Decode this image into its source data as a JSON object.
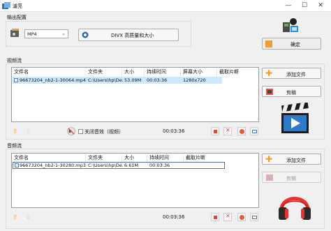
{
  "window": {
    "title": "濾亮",
    "controls": [
      "—",
      "☐",
      "✕"
    ]
  },
  "output_config": {
    "label": "输出配置",
    "format": "MP4",
    "quality": "DIVX 高质量和大小",
    "ok_label": "确定"
  },
  "video": {
    "label": "视频流",
    "columns": [
      "文件名",
      "文件夹",
      "大小",
      "持续时间",
      "屏幕大小",
      "截取片断"
    ],
    "rows": [
      {
        "name": "96673204_nb2-1-30064.mp4",
        "folder": "C:\\Users\\hp\\De...",
        "size": "53.09M",
        "duration": "00:03:36",
        "screen": "1280x720",
        "clip": ""
      }
    ],
    "add_label": "添加文件",
    "edit_label": "剪辑",
    "mute_label": "关闭音效（视频）",
    "total_time": "00:03:36"
  },
  "audio": {
    "label": "音频流",
    "columns": [
      "文件名",
      "文件夹",
      "大小",
      "持续时间",
      "截取片断"
    ],
    "rows": [
      {
        "name": "96673204_nb2-1-30280.mp3",
        "folder": "C:\\Users\\hp\\De...",
        "size": "6.61M",
        "duration": "00:03:36",
        "clip": ""
      }
    ],
    "add_label": "添加文件",
    "edit_label": "剪辑",
    "total_time": "00:03:36"
  },
  "colors": {
    "accent_orange": "#f39c2c",
    "selection": "#cce8ff",
    "headphone_red": "#e8322d"
  }
}
